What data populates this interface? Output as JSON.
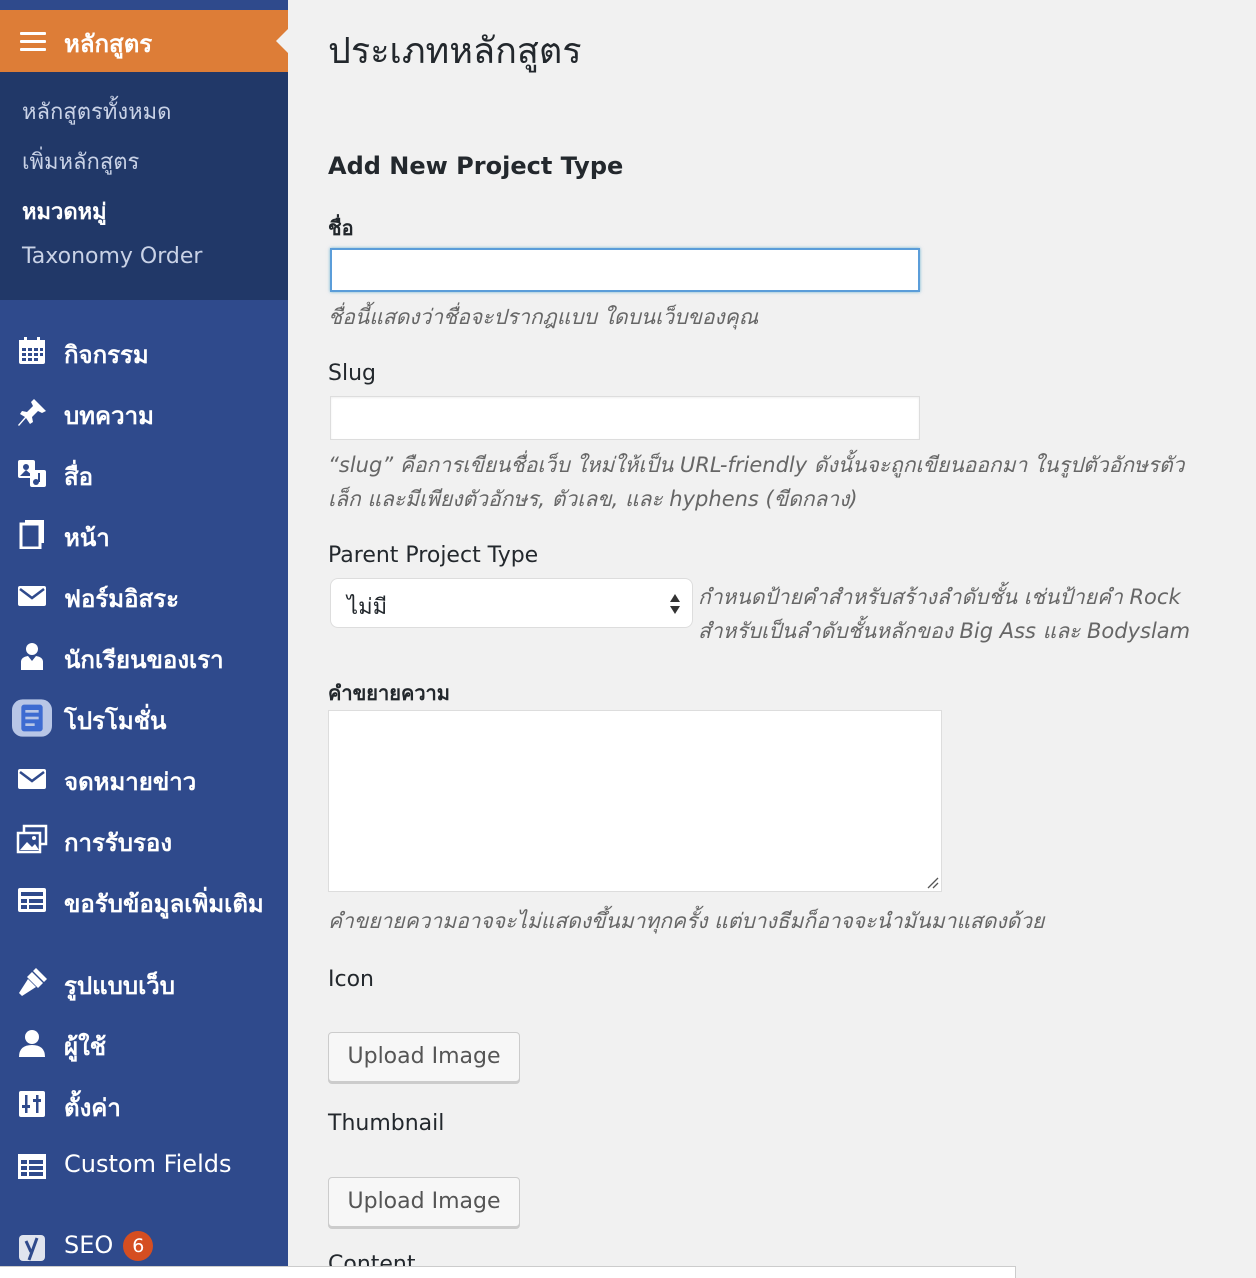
{
  "sidebar": {
    "current": {
      "label": "หลักสูตร"
    },
    "submenu": [
      {
        "label": "หลักสูตรทั้งหมด"
      },
      {
        "label": "เพิ่มหลักสูตร"
      },
      {
        "label": "หมวดหมู่"
      },
      {
        "label": "Taxonomy Order"
      }
    ],
    "items": [
      {
        "label": "กิจกรรม",
        "icon": "calendar-icon"
      },
      {
        "label": "บทความ",
        "icon": "pin-icon"
      },
      {
        "label": "สื่อ",
        "icon": "media-icon"
      },
      {
        "label": "หน้า",
        "icon": "page-icon"
      },
      {
        "label": "ฟอร์มอิสระ",
        "icon": "mail-icon"
      },
      {
        "label": "นักเรียนของเรา",
        "icon": "student-icon"
      },
      {
        "label": "โปรโมชั่น",
        "icon": "promo-icon"
      },
      {
        "label": "จดหมายข่าว",
        "icon": "mail-icon"
      },
      {
        "label": "การรับรอง",
        "icon": "gallery-icon"
      },
      {
        "label": "ขอรับข้อมูลเพิ่มเติม",
        "icon": "form-icon"
      },
      {
        "label": "รูปแบบเว็บ",
        "icon": "brush-icon"
      },
      {
        "label": "ผู้ใช้",
        "icon": "user-icon"
      },
      {
        "label": "ตั้งค่า",
        "icon": "settings-icon"
      },
      {
        "label": "Custom Fields",
        "icon": "table-icon"
      },
      {
        "label": "SEO",
        "icon": "yoast-icon",
        "badge": "6"
      }
    ]
  },
  "page": {
    "title": "ประเภทหลักสูตร",
    "form_title": "Add New Project Type",
    "name": {
      "label": "ชื่อ",
      "value": "",
      "desc": "ชื่อนี้แสดงว่าชื่อจะปรากฎแบบ ใดบนเว็บของคุณ"
    },
    "slug": {
      "label": "Slug",
      "value": "",
      "desc_line1": "“slug” คือการเขียนชื่อเว็บ ใหม่ให้เป็น URL-friendly ดังนั้นจะถูกเขียนออกมา ในรูปตัวอักษรตัว",
      "desc_line2": "เล็ก และมีเพียงตัวอักษร, ตัวเลข, และ hyphens (ขีดกลาง)"
    },
    "parent": {
      "label": "Parent Project Type",
      "selected": "ไม่มี",
      "desc_line1": "กำหนดป้ายคำสำหรับสร้างลำดับชั้น เช่นป้ายคำ Rock",
      "desc_line2": "สำหรับเป็นลำดับชั้นหลักของ Big Ass และ Bodyslam"
    },
    "description": {
      "label": "คำขยายความ",
      "value": "",
      "desc": "คำขยายความอาจจะไม่แสดงขึ้นมาทุกครั้ง แต่บางธีมก็อาจจะนำมันมาแสดงด้วย"
    },
    "icon": {
      "label": "Icon",
      "button": "Upload Image"
    },
    "thumbnail": {
      "label": "Thumbnail",
      "button": "Upload Image"
    },
    "content": {
      "label": "Content"
    }
  },
  "colors": {
    "sidebar": "#2f4a8c",
    "submenu": "#213868",
    "current": "#dd7d37",
    "badge": "#d54e21",
    "focus": "#5b9dd9"
  }
}
